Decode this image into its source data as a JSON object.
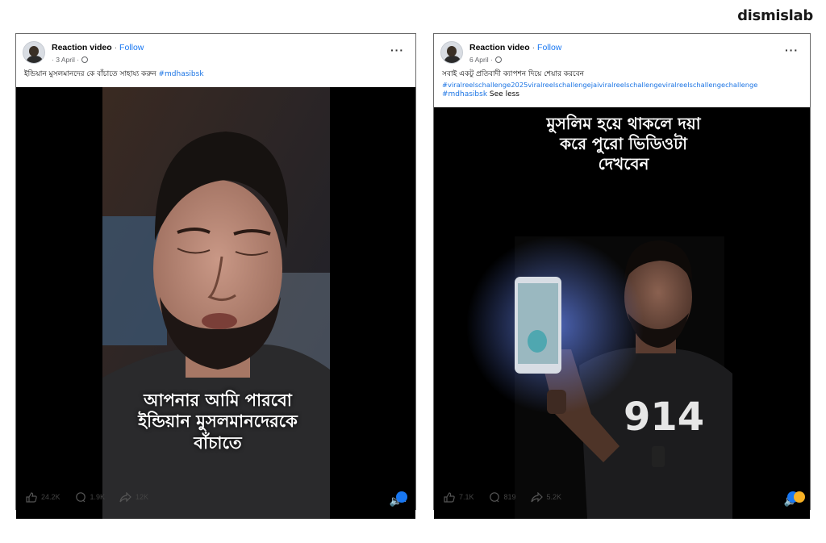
{
  "brand": "dismislab",
  "posts": [
    {
      "author": "Reaction video",
      "follow": "Follow",
      "date": "3 April",
      "caption": "ইন্ডিয়ান মুসলমানদের কে বাঁচাতে সাহায্য করুন",
      "hashtags": "#mdhasibsk",
      "overlay": [
        "আপনার আমি পারবো",
        "ইন্ডিয়ান মুসলমানদেরকে",
        "বাঁচাতে"
      ],
      "likes": "24.2K",
      "comments": "1.9K",
      "shares": "12K"
    },
    {
      "author": "Reaction video",
      "follow": "Follow",
      "date": "6 April",
      "caption": "সবাই একটু প্রতিবাদী ক্যাপশন দিয়ে শেয়ার করবেন",
      "hashtags": "#viralreelschallenge2025viralreelschallengejaiviralreelschallengeviralreelschallengechallenge",
      "hashtags2": "#mdhasibsk",
      "see_less": "See less",
      "overlay": [
        "মুসলিম হয়ে থাকলে দয়া",
        "করে পুরো ভিডিওটা",
        "দেখবেন"
      ],
      "shirt_text": "914",
      "likes": "7.1K",
      "comments": "819",
      "shares": "5.2K"
    }
  ]
}
